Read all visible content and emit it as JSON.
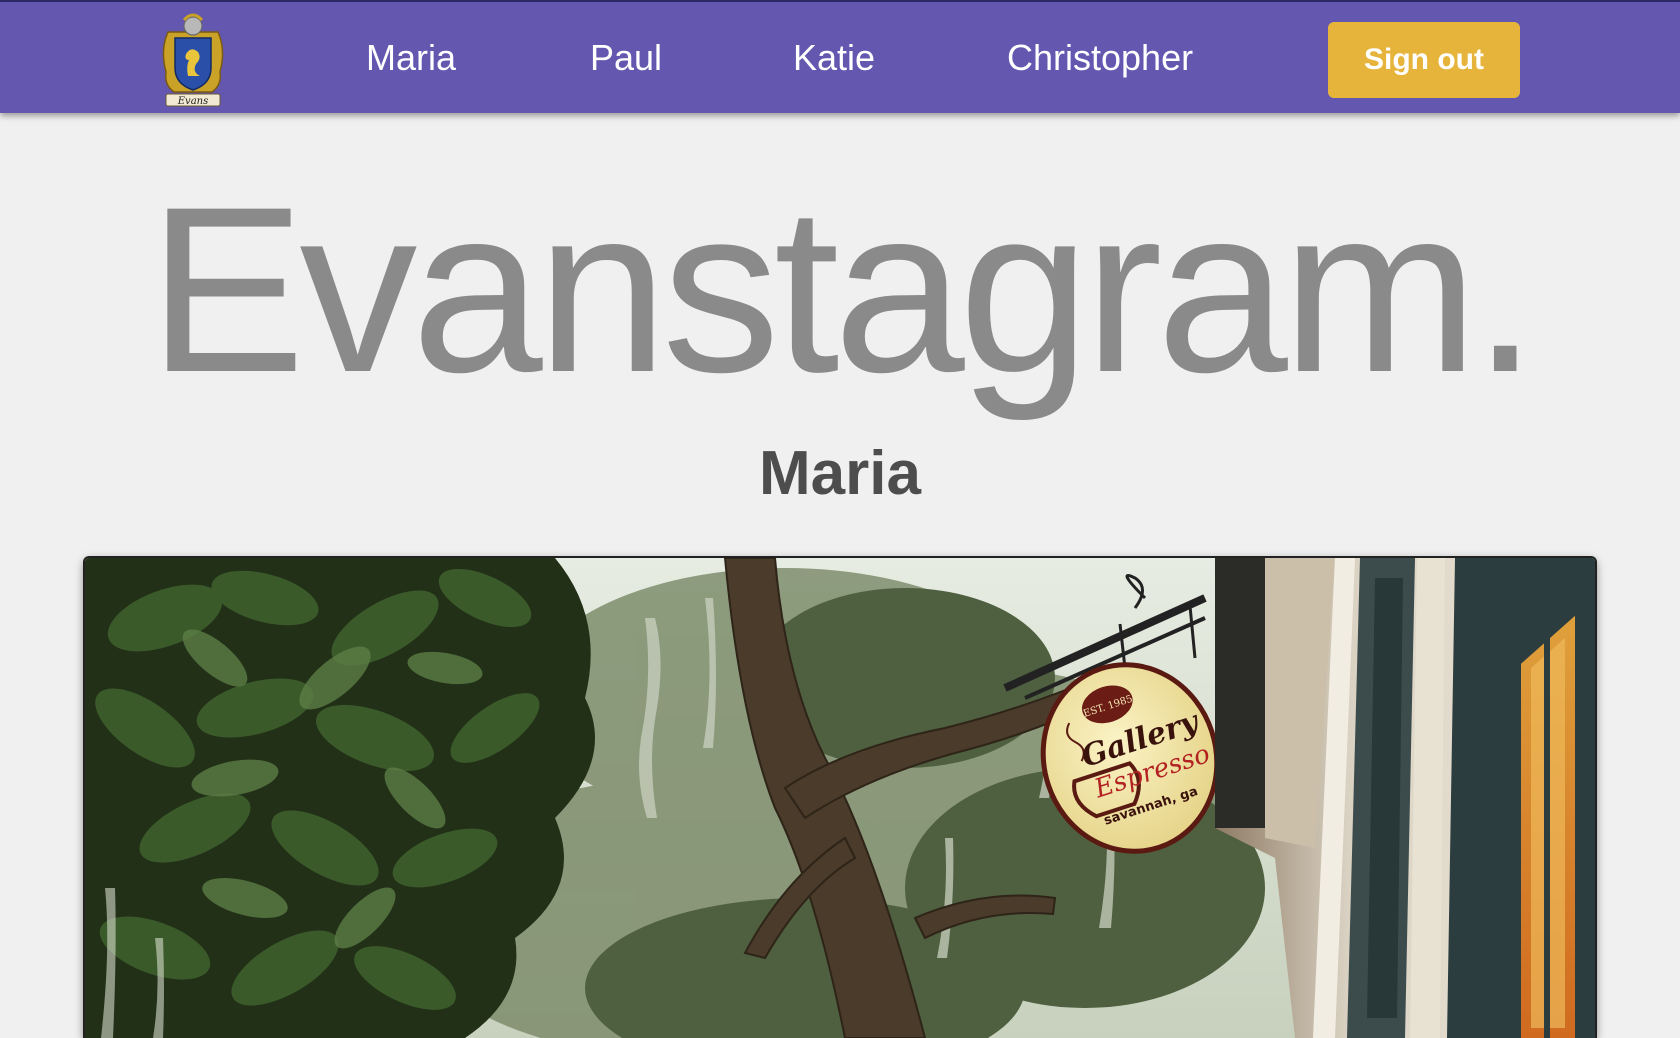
{
  "header": {
    "logo_icon": "family-crest-icon",
    "logo_text": "Evans",
    "nav": [
      {
        "label": "Maria"
      },
      {
        "label": "Paul"
      },
      {
        "label": "Katie"
      },
      {
        "label": "Christopher"
      }
    ],
    "sign_out_label": "Sign out",
    "colors": {
      "navbar": "#6457b0",
      "sign_out_button": "#e6b43a"
    }
  },
  "main": {
    "brand_title": "Evanstagram.",
    "profile_name": "Maria",
    "photo": {
      "sign": {
        "established": "EST. 1985",
        "name_line1": "Gallery",
        "name_line2": "Espresso",
        "location": "savannah, ga"
      }
    }
  }
}
